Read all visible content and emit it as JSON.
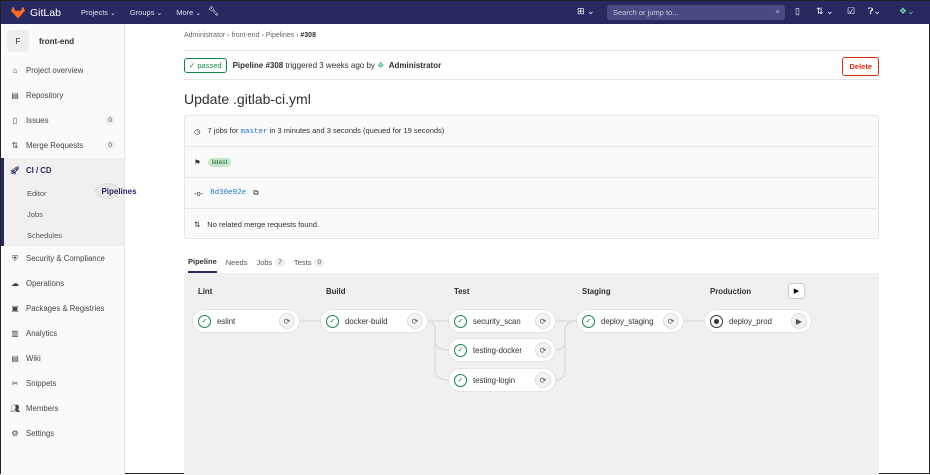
{
  "nav": {
    "brand": "GitLab",
    "items": [
      "Projects",
      "Groups",
      "More"
    ],
    "search_placeholder": "Search or jump to..."
  },
  "sidebar": {
    "project_initial": "F",
    "project_name": "front-end",
    "items": [
      {
        "label": "Project overview",
        "icon": "home-icon"
      },
      {
        "label": "Repository",
        "icon": "book-icon"
      },
      {
        "label": "Issues",
        "icon": "issues-icon",
        "count": "0"
      },
      {
        "label": "Merge Requests",
        "icon": "merge-request-icon",
        "count": "0"
      }
    ],
    "cicd": {
      "label": "CI / CD",
      "sub": [
        "Pipelines",
        "Editor",
        "Jobs",
        "Schedules"
      ]
    },
    "items2": [
      {
        "label": "Security & Compliance"
      },
      {
        "label": "Operations"
      },
      {
        "label": "Packages & Registries"
      },
      {
        "label": "Analytics"
      },
      {
        "label": "Wiki"
      },
      {
        "label": "Snippets"
      },
      {
        "label": "Members"
      },
      {
        "label": "Settings"
      }
    ]
  },
  "breadcrumb": [
    "Administrator",
    "front-end",
    "Pipelines",
    "#308"
  ],
  "header": {
    "status": "passed",
    "pipeline": "Pipeline #308",
    "triggered": "triggered 3 weeks ago by",
    "user": "Administrator",
    "delete": "Delete"
  },
  "title": "Update .gitlab-ci.yml",
  "info": {
    "jobs_pre": "7 jobs for",
    "branch": "master",
    "jobs_post": "in 3 minutes and 3 seconds (queued for 19 seconds)",
    "tag": "latest",
    "commit": "8d30e92e",
    "mr": "No related merge requests found."
  },
  "tabs": [
    {
      "label": "Pipeline"
    },
    {
      "label": "Needs"
    },
    {
      "label": "Jobs",
      "count": "7"
    },
    {
      "label": "Tests",
      "count": "0"
    }
  ],
  "stages": [
    {
      "name": "Lint",
      "jobs": [
        "eslint"
      ]
    },
    {
      "name": "Build",
      "jobs": [
        "docker-build"
      ]
    },
    {
      "name": "Test",
      "jobs": [
        "security_scan",
        "testing-docker",
        "testing-login"
      ]
    },
    {
      "name": "Staging",
      "jobs": [
        "deploy_staging"
      ]
    },
    {
      "name": "Production",
      "jobs": [
        "deploy_prod"
      ]
    }
  ],
  "colors": {
    "nav": "#292961",
    "success": "#108548",
    "danger": "#dd2b0e"
  }
}
